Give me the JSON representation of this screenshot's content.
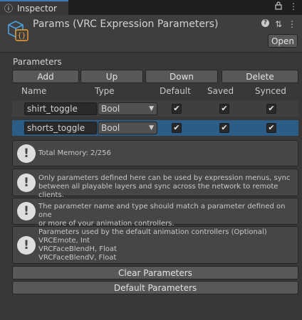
{
  "tab": {
    "title": "Inspector",
    "icon": "info-icon",
    "lock_icon": "lock-icon",
    "menu_icon": "kebab-menu-icon"
  },
  "header": {
    "title": "Params (VRC Expression Parameters)",
    "asset_icon": "scriptable-object-icon",
    "help_icon": "help-icon",
    "settings_icon": "sliders-icon",
    "menu_icon": "kebab-menu-icon",
    "open_label": "Open"
  },
  "parameters": {
    "section_label": "Parameters",
    "buttons": {
      "add": "Add",
      "up": "Up",
      "down": "Down",
      "delete": "Delete"
    },
    "columns": {
      "name": "Name",
      "type": "Type",
      "default": "Default",
      "saved": "Saved",
      "synced": "Synced"
    },
    "rows": [
      {
        "name": "shirt_toggle",
        "type": "Bool",
        "default": true,
        "saved": true,
        "synced": true,
        "selected": false
      },
      {
        "name": "shorts_toggle",
        "type": "Bool",
        "default": true,
        "saved": true,
        "synced": true,
        "selected": true
      }
    ],
    "check_glyph": "✔"
  },
  "help_boxes": [
    {
      "icon": "warning-icon",
      "glyph": "!",
      "text": "Total Memory: 2/256"
    },
    {
      "icon": "warning-icon",
      "glyph": "!",
      "text": "Only parameters defined here can be used by expression menus, sync\nbetween all playable layers and sync across the network to remote clients."
    },
    {
      "icon": "warning-icon",
      "glyph": "!",
      "text": "The parameter name and type should match a parameter defined on one\nor more of your animation controllers."
    },
    {
      "icon": "warning-icon",
      "glyph": "!",
      "text": "Parameters used by the default animation controllers (Optional)\nVRCEmote, Int\nVRCFaceBlendH, Float\nVRCFaceBlendV, Float"
    }
  ],
  "actions": {
    "clear": "Clear Parameters",
    "default": "Default Parameters"
  },
  "colors": {
    "accent": "#3a79bb",
    "selected_row": "#2c5d87",
    "icon_blue": "#4aa3df",
    "icon_orange": "#f0a030"
  }
}
